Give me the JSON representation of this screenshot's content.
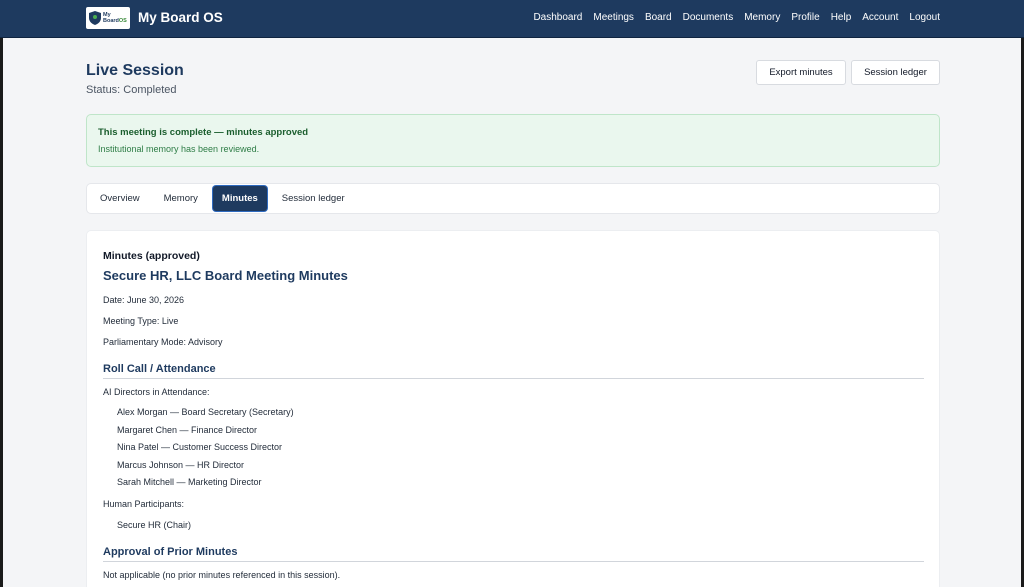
{
  "nav": {
    "logo_text_line1": "My",
    "logo_text_line2": "Board",
    "logo_text_os": "OS",
    "brand": "My Board OS",
    "links": [
      "Dashboard",
      "Meetings",
      "Board",
      "Documents",
      "Memory",
      "Profile",
      "Help",
      "Account",
      "Logout"
    ]
  },
  "header": {
    "title": "Live Session",
    "status": "Status: Completed",
    "export_label": "Export minutes",
    "ledger_label": "Session ledger"
  },
  "alert": {
    "title": "This meeting is complete — minutes approved",
    "body": "Institutional memory has been reviewed.",
    "colors": {
      "background": "#eaf7ee",
      "text": "#1b5e2e"
    }
  },
  "tabs": [
    {
      "label": "Overview",
      "active": false
    },
    {
      "label": "Memory",
      "active": false
    },
    {
      "label": "Minutes",
      "active": true
    },
    {
      "label": "Session ledger",
      "active": false
    }
  ],
  "minutes": {
    "section_label": "Minutes (approved)",
    "doc_title": "Secure HR, LLC Board Meeting Minutes",
    "date": "Date: June 30, 2026",
    "meeting_type": "Meeting Type: Live",
    "mode": "Parliamentary Mode: Advisory",
    "roll_call_heading": "Roll Call / Attendance",
    "ai_directors_label": "AI Directors in Attendance:",
    "ai_directors": [
      "Alex Morgan — Board Secretary (Secretary)",
      "Margaret Chen — Finance Director",
      "Nina Patel — Customer Success Director",
      "Marcus Johnson — HR Director",
      "Sarah Mitchell — Marketing Director"
    ],
    "human_label": "Human Participants:",
    "humans": [
      "Secure HR (Chair)"
    ],
    "approval_heading": "Approval of Prior Minutes",
    "approval_text": "Not applicable (no prior minutes referenced in this session)."
  },
  "colors": {
    "navbar": "#1e3a5f",
    "accent": "#1e3a5f",
    "page_bg": "#f4f5f7"
  }
}
